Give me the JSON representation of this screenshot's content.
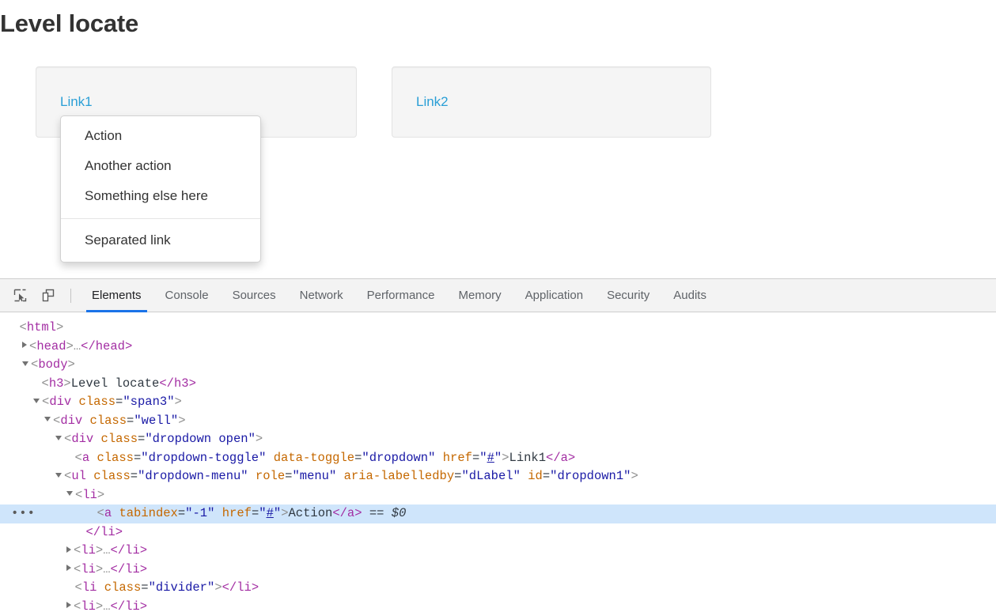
{
  "page": {
    "title": "Level locate",
    "wells": [
      {
        "link_label": "Link1"
      },
      {
        "link_label": "Link2"
      }
    ],
    "dropdown": {
      "items": [
        {
          "label": "Action"
        },
        {
          "label": "Another action"
        },
        {
          "label": "Something else here"
        },
        {
          "label": "Separated link"
        }
      ]
    }
  },
  "devtools": {
    "toolbar": {
      "inspect_icon": "inspect-element-icon",
      "device_icon": "device-toolbar-icon"
    },
    "tabs": [
      {
        "label": "Elements",
        "active": true
      },
      {
        "label": "Console",
        "active": false
      },
      {
        "label": "Sources",
        "active": false
      },
      {
        "label": "Network",
        "active": false
      },
      {
        "label": "Performance",
        "active": false
      },
      {
        "label": "Memory",
        "active": false
      },
      {
        "label": "Application",
        "active": false
      },
      {
        "label": "Security",
        "active": false
      },
      {
        "label": "Audits",
        "active": false
      }
    ],
    "active_tab_accent": "#1a73e8",
    "selection_highlight": "#cfe5fb",
    "dom_tree": {
      "l1": {
        "open": "<",
        "tag": "html",
        "close": ">"
      },
      "l2": {
        "open": "<",
        "tag": "head",
        "ellipsis": "…",
        "closetag": "</head>"
      },
      "l3": {
        "tag": "body"
      },
      "l4": {
        "tag": "h3",
        "text": "Level locate",
        "closetag": "</h3>"
      },
      "l5": {
        "tag": "div",
        "attr": "class",
        "value": "span3"
      },
      "l6": {
        "tag": "div",
        "attr": "class",
        "value": "well"
      },
      "l7": {
        "tag": "div",
        "attr": "class",
        "value": "dropdown open"
      },
      "l8": {
        "tag": "a",
        "attr1": "class",
        "value1": "dropdown-toggle",
        "attr2": "data-toggle",
        "value2": "dropdown",
        "attr3": "href",
        "value3": "#",
        "text": "Link1",
        "closetag": "</a>"
      },
      "l9": {
        "tag": "ul",
        "attr1": "class",
        "value1": "dropdown-menu",
        "attr2": "role",
        "value2": "menu",
        "attr3": "aria-labelledby",
        "value3": "dLabel",
        "attr4": "id",
        "value4": "dropdown1"
      },
      "l10": {
        "tag": "li"
      },
      "l11": {
        "tag": "a",
        "attr1": "tabindex",
        "value1": "-1",
        "attr2": "href",
        "value2": "#",
        "text": "Action",
        "closetag": "</a>",
        "suffix_eq": "==",
        "suffix_var": "$0",
        "gutter": "•••"
      },
      "l12": {
        "closetag": "</li>"
      },
      "l13": {
        "tag": "li",
        "ellipsis": "…",
        "closetag": "</li>"
      },
      "l14": {
        "tag": "li",
        "ellipsis": "…",
        "closetag": "</li>"
      },
      "l15": {
        "tag": "li",
        "attr": "class",
        "value": "divider",
        "closetag": "</li>"
      },
      "l16": {
        "tag": "li",
        "ellipsis": "…",
        "closetag": "</li>"
      }
    }
  }
}
